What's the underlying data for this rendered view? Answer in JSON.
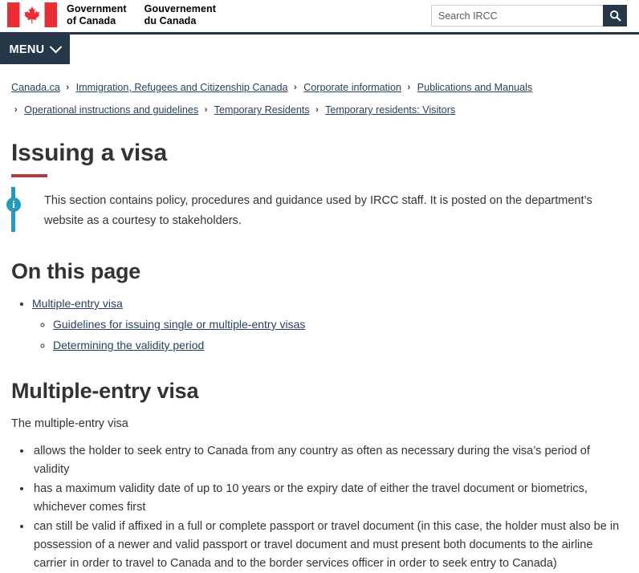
{
  "header": {
    "flag_alt": "canada-flag",
    "wordmark_en_line1": "Government",
    "wordmark_en_line2": "of Canada",
    "wordmark_fr_line1": "Gouvernement",
    "wordmark_fr_line2": "du Canada",
    "search_placeholder": "Search IRCC",
    "search_value": "",
    "search_button_icon": "search-icon"
  },
  "menu": {
    "label": "MENU",
    "chevron_icon": "chevron-down-icon"
  },
  "breadcrumb": {
    "separator": "›",
    "row1": [
      "Canada.ca",
      "Immigration, Refugees and Citizenship Canada",
      "Corporate information",
      "Publications and Manuals"
    ],
    "row2": [
      "Operational instructions and guidelines",
      "Temporary Residents",
      "Temporary residents: Visitors"
    ]
  },
  "page": {
    "title": "Issuing a visa",
    "callout": {
      "icon": "info-icon",
      "text": "This section contains policy, procedures and guidance used by IRCC staff. It is posted on the department’s website as a courtesy to stakeholders."
    },
    "on_this_page": {
      "heading": "On this page",
      "items": [
        {
          "label": "Multiple-entry visa",
          "children": [
            "Guidelines for issuing single or multiple-entry visas",
            "Determining the validity period"
          ]
        }
      ]
    },
    "section": {
      "heading": "Multiple-entry visa",
      "lead": "The multiple-entry visa",
      "bullets": [
        "allows the holder to seek entry to Canada from any country as often as necessary during the visa’s period of validity",
        "has a maximum validity date of up to 10 years or the expiry date of either the travel document or biometrics, whichever comes first",
        "can still be valid if affixed in a full or complete passport or travel document (in this case, the holder must also be in possession of a newer and valid passport or travel document and must present both documents to the airline carrier in order to travel to Canada and to the border services officer in order to seek entry to Canada)"
      ]
    }
  },
  "colors": {
    "navy": "#26374A",
    "red": "#AF3C43",
    "link": "#284162",
    "info_teal": "#269abc",
    "text": "#333333"
  }
}
